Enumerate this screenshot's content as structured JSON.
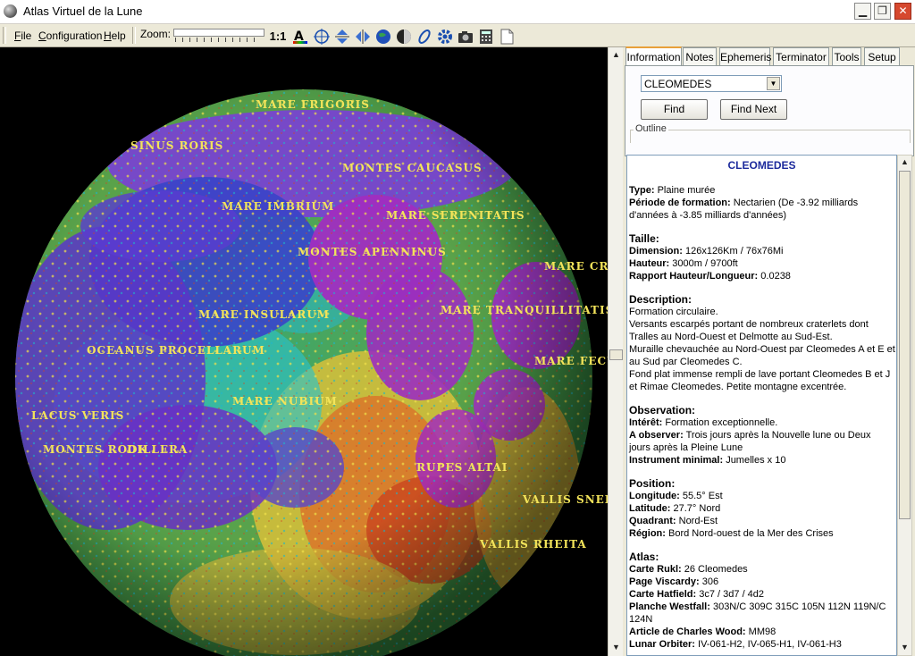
{
  "window": {
    "title": "Atlas Virtuel de la Lune"
  },
  "menu": [
    {
      "label": "File",
      "ul": "F",
      "rest": "ile"
    },
    {
      "label": "Configuration",
      "ul": "C",
      "rest": "onfiguration"
    },
    {
      "label": "Help",
      "ul": "H",
      "rest": "elp"
    }
  ],
  "toolbar": {
    "zoom_label": "Zoom:",
    "ratio_label": "1:1"
  },
  "map": {
    "labels": [
      {
        "text": "MARE FRIGORIS"
      },
      {
        "text": "SINUS RORIS"
      },
      {
        "text": "MONTES CAUCASUS"
      },
      {
        "text": "MARE IMBRIUM"
      },
      {
        "text": "MARE SERENITATIS"
      },
      {
        "text": "MONTES APENNINUS"
      },
      {
        "text": "MARE CR"
      },
      {
        "text": "MARE INSULARUM"
      },
      {
        "text": "MARE TRANQUILLITATIS"
      },
      {
        "text": "OCEANUS PROCELLARUM"
      },
      {
        "text": "MARE FECU"
      },
      {
        "text": "MARE NUBIUM"
      },
      {
        "text": "LACUS VERIS"
      },
      {
        "text": "MONTES ROOK"
      },
      {
        "text": "DILLERA"
      },
      {
        "text": "RUPES ALTAI"
      },
      {
        "text": "VALLIS SNEL"
      },
      {
        "text": "VALLIS RHEITA"
      }
    ]
  },
  "tabs": [
    "Information",
    "Notes",
    "Ephemeris",
    "Terminator",
    "Tools",
    "Setup"
  ],
  "search": {
    "selected": "CLEOMEDES",
    "find_label": "Find",
    "find_next_label": "Find Next",
    "outline_label": "Outline"
  },
  "info": {
    "title": "CLEOMEDES",
    "type_label": "Type:",
    "type_value": "Plaine murée",
    "period_label": "Période de formation:",
    "period_value": "Nectarien (De -3.92 milliards",
    "period_value2": "d'années à -3.85 milliards d'années)",
    "size_heading": "Taille:",
    "dimension_label": "Dimension:",
    "dimension_value": "126x126Km / 76x76Mi",
    "height_label": "Hauteur:",
    "height_value": "3000m / 9700ft",
    "ratio_label": "Rapport Hauteur/Longueur:",
    "ratio_value": "0.0238",
    "desc_heading": "Description:",
    "desc_lines": [
      "Formation circulaire.",
      "Versants escarpés portant de nombreux craterlets dont",
      "Tralles au Nord-Ouest et Delmotte au Sud-Est.",
      "Muraille chevauchée au Nord-Ouest par Cleomedes A et E et",
      "au Sud par Cleomedes C.",
      "Fond plat immense rempli de lave portant Cleomedes B et J",
      "et Rimae Cleomedes. Petite montagne excentrée."
    ],
    "obs_heading": "Observation:",
    "interest_label": "Intérêt:",
    "interest_value": "Formation exceptionnelle.",
    "observe_label": "A observer:",
    "observe_value": "Trois jours après la Nouvelle lune ou Deux",
    "observe_value2": "jours après la Pleine Lune",
    "instrument_label": "Instrument minimal:",
    "instrument_value": "Jumelles x 10",
    "pos_heading": "Position:",
    "lon_label": "Longitude:",
    "lon_value": "55.5° Est",
    "lat_label": "Latitude:",
    "lat_value": "27.7° Nord",
    "quad_label": "Quadrant:",
    "quad_value": "Nord-Est",
    "region_label": "Région:",
    "region_value": "Bord Nord-ouest de la Mer des Crises",
    "atlas_heading": "Atlas:",
    "rukl_label": "Carte Rukl:",
    "rukl_value": "26 Cleomedes",
    "viscardy_label": "Page Viscardy:",
    "viscardy_value": "306",
    "hatfield_label": "Carte Hatfield:",
    "hatfield_value": "3c7 / 3d7 / 4d2",
    "westfall_label": "Planche Westfall:",
    "westfall_value": "303N/C 309C 315C 105N 112N 119N/C",
    "westfall_value2": "124N",
    "wood_label": "Article de Charles Wood:",
    "wood_value": "MM98",
    "orbiter_label": "Lunar Orbiter:",
    "orbiter_value": "IV-061-H2, IV-065-H1, IV-061-H3"
  },
  "icons": [
    "moon-app-icon",
    "minimize-icon",
    "maximize-icon",
    "close-icon",
    "text-color-icon",
    "crosshair-icon",
    "flip-vertical-icon",
    "flip-horizontal-icon",
    "globe-icon",
    "phase-icon",
    "rotate-icon",
    "gear-icon",
    "camera-icon",
    "calculator-icon",
    "page-icon"
  ]
}
